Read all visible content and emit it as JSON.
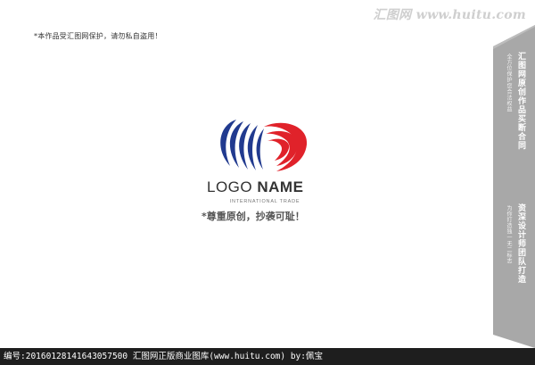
{
  "notice": "*本作品受汇图网保护，请勿私自盗用！",
  "watermark": "汇图网 www.huitu.com",
  "side_band": {
    "main_top": "汇图网原创作品买断合同",
    "sub_top": "全方位保护您合法权益",
    "main_bottom": "资深设计师团队打造",
    "sub_bottom": "为你打造独一无二标志"
  },
  "logo": {
    "name_light": "LOGO ",
    "name_bold": "NAME",
    "subtitle": "INTERNATIONAL TRADE",
    "colors": {
      "blue": "#213a8f",
      "red": "#e0222a"
    }
  },
  "slogan": "*尊重原创，抄袭可耻！",
  "footer": "编号:20160128141643057500   汇图网正版商业图库(www.huitu.com)  by:佩宝",
  "colors": {
    "band": "#a8a8a8",
    "footer_bg": "#1e1e1e"
  }
}
